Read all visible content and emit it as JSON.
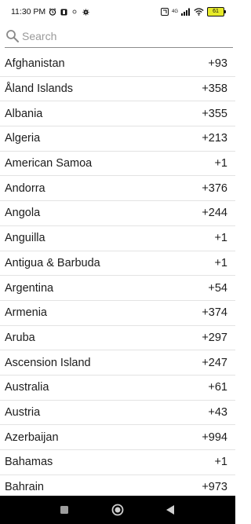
{
  "status_bar": {
    "time": "11:30 PM",
    "network": "4G",
    "battery": "61"
  },
  "search": {
    "placeholder": "Search",
    "value": ""
  },
  "countries": [
    {
      "name": "Afghanistan",
      "code": "+93"
    },
    {
      "name": "Åland Islands",
      "code": "+358"
    },
    {
      "name": "Albania",
      "code": "+355"
    },
    {
      "name": "Algeria",
      "code": "+213"
    },
    {
      "name": "American Samoa",
      "code": "+1"
    },
    {
      "name": "Andorra",
      "code": "+376"
    },
    {
      "name": "Angola",
      "code": "+244"
    },
    {
      "name": "Anguilla",
      "code": "+1"
    },
    {
      "name": "Antigua & Barbuda",
      "code": "+1"
    },
    {
      "name": "Argentina",
      "code": "+54"
    },
    {
      "name": "Armenia",
      "code": "+374"
    },
    {
      "name": "Aruba",
      "code": "+297"
    },
    {
      "name": "Ascension Island",
      "code": "+247"
    },
    {
      "name": "Australia",
      "code": "+61"
    },
    {
      "name": "Austria",
      "code": "+43"
    },
    {
      "name": "Azerbaijan",
      "code": "+994"
    },
    {
      "name": "Bahamas",
      "code": "+1"
    },
    {
      "name": "Bahrain",
      "code": "+973"
    }
  ],
  "nav_bar": {
    "buttons": [
      "recents-icon",
      "home-icon",
      "back-icon"
    ]
  },
  "colors": {
    "background": "#ffffff",
    "divider": "#e3e3e3",
    "text": "#1c1c1c",
    "placeholder": "#9a9a9a",
    "nav_bar": "#000000",
    "battery_fill": "#e6ea2a"
  }
}
